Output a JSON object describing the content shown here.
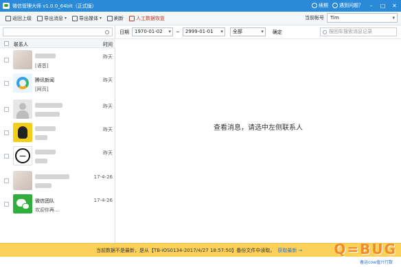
{
  "window": {
    "title": "微信管理大师 v1.0.0_64bit（正式版）",
    "links": [
      {
        "label": "续期",
        "icon": "renew-icon"
      },
      {
        "label": "遇到问题？",
        "icon": "help-icon"
      }
    ]
  },
  "toolbar": {
    "items": [
      {
        "label": "返回上级",
        "icon": "back-icon"
      },
      {
        "label": "导出消息",
        "icon": "export-message-icon",
        "dropdown": true
      },
      {
        "label": "导出媒体",
        "icon": "export-media-icon",
        "dropdown": true
      },
      {
        "label": "刷新",
        "icon": "refresh-icon"
      },
      {
        "label": "人工数据恢复",
        "icon": "manual-recovery-icon"
      }
    ],
    "account_label": "当前帐号",
    "account_value": "Tim"
  },
  "contacts": {
    "header_contact": "联系人",
    "header_time": "时间",
    "rows": [
      {
        "name": "",
        "message": "[语音]",
        "time": "昨天",
        "avatar": "blurred-avatar"
      },
      {
        "name": "腾讯新闻",
        "message": "[网页]",
        "time": "昨天",
        "avatar": "tencent-news-avatar"
      },
      {
        "name": "",
        "message": "",
        "time": "昨天",
        "avatar": "default-avatar"
      },
      {
        "name": "",
        "message": "",
        "time": "昨天",
        "avatar": "yellow-avatar"
      },
      {
        "name": "",
        "message": "",
        "time": "昨天",
        "avatar": "yi-tiao-avatar"
      },
      {
        "name": "",
        "message": "",
        "time": "17-4-26",
        "avatar": "blurred-avatar"
      },
      {
        "name": "微信团队",
        "message": "欢迎你再...",
        "time": "17-4-26",
        "avatar": "wechat-avatar"
      }
    ]
  },
  "filter": {
    "date_label": "日期",
    "start_date": "1970-01-02",
    "separator": "~",
    "end_date": "2999-01-01",
    "type_value": "全部",
    "confirm_label": "确定",
    "search_placeholder": "按回车搜索消息记录"
  },
  "main": {
    "placeholder": "查看消息，请选中左侧联系人"
  },
  "status": {
    "text": "当前数据不是最新，是从【TB-iOS0134-2017/4/27 18:57:50】备份文件中读取。",
    "link": "获取最新",
    "arrow": "→"
  },
  "watermark": "Q=BUG",
  "footer": "备运cow值兴行数"
}
